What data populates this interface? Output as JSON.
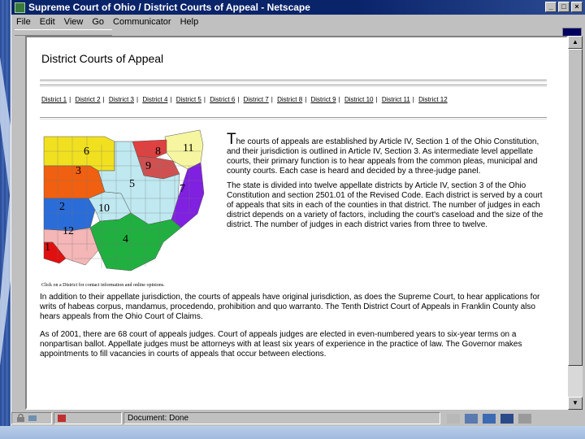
{
  "window": {
    "title": "Supreme Court of Ohio / District Courts of Appeal - Netscape",
    "buttons": [
      "_",
      "□",
      "×"
    ]
  },
  "menu": [
    "File",
    "Edit",
    "View",
    "Go",
    "Communicator",
    "Help"
  ],
  "page": {
    "title": "District Courts of Appeal",
    "district_links": [
      "District 1",
      "District 2",
      "District 3",
      "District 4",
      "District 5",
      "District 6",
      "District 7",
      "District 8",
      "District 9",
      "District 10",
      "District 11",
      "District 12"
    ],
    "map": {
      "labels": [
        "1",
        "2",
        "3",
        "4",
        "5",
        "6",
        "7",
        "8",
        "9",
        "10",
        "11",
        "12"
      ],
      "colors": {
        "d1": "#e01010",
        "d2": "#2a6cd8",
        "d3": "#f06010",
        "d4": "#20b040",
        "d5": "#bfe8f0",
        "d6": "#f0e020",
        "d7": "#8020e0",
        "d8": "#e04040",
        "d9": "#d05050",
        "d10": "#bfe8f0",
        "d11": "#f6f6a0",
        "d12": "#f4b6b6"
      },
      "caption": "Click on a District for contact information and online opinions."
    },
    "para1_dropcap": "T",
    "para1": "he courts of appeals are established by Article IV, Section 1 of the Ohio Constitution, and their jurisdiction is outlined in Article IV, Section 3. As intermediate level appellate courts, their primary function is to hear appeals from the common pleas, municipal and county courts. Each case is heard and decided by a three-judge panel.",
    "para2": "The state is divided into twelve appellate districts by Article IV, section 3 of the Ohio Constitution and section 2501.01 of the Revised Code. Each district is served by a court of appeals that sits in each of the counties in that district. The number of judges in each district depends on a variety of factors, including the court's caseload and the size of the district. The number of judges in each district varies from three to twelve.",
    "para3": "In addition to their appellate jurisdiction, the courts of appeals have original jurisdiction, as does the Supreme Court, to hear applications for writs of habeas corpus, mandamus, procedendo, prohibition and quo warranto. The Tenth District Court of Appeals in Franklin County also hears appeals from the Ohio Court of Claims.",
    "para4": "As of 2001, there are 68 court of appeals judges. Court of appeals judges are elected in even-numbered years to six-year terms on a nonpartisan ballot. Appellate judges must be attorneys with at least six years of experience in the practice of law. The Governor makes appointments to fill vacancies in courts of appeals that occur between elections."
  },
  "status": {
    "text": "Document: Done"
  }
}
